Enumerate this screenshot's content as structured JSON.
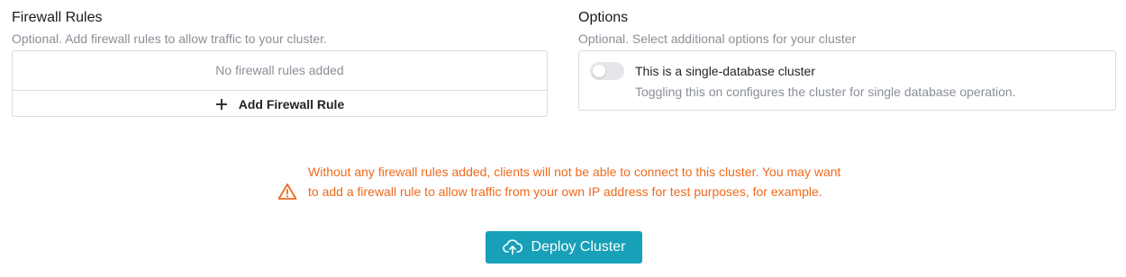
{
  "firewall": {
    "title": "Firewall Rules",
    "subtitle": "Optional. Add firewall rules to allow traffic to your cluster.",
    "empty_text": "No firewall rules added",
    "add_label": "Add Firewall Rule",
    "add_icon": "plus-icon"
  },
  "options": {
    "title": "Options",
    "subtitle": "Optional. Select additional options for your cluster",
    "single_db": {
      "label": "This is a single-database cluster",
      "description": "Toggling this on configures the cluster for single database operation.",
      "enabled": false
    }
  },
  "warning": {
    "icon": "warning-triangle-icon",
    "text": "Without any firewall rules added, clients will not be able to connect to this cluster. You may want to add a firewall rule to allow traffic from your own IP address for test purposes, for example.",
    "color": "#ee6a1d"
  },
  "deploy": {
    "label": "Deploy Cluster",
    "icon": "cloud-upload-icon",
    "color": "#17a0b8"
  }
}
